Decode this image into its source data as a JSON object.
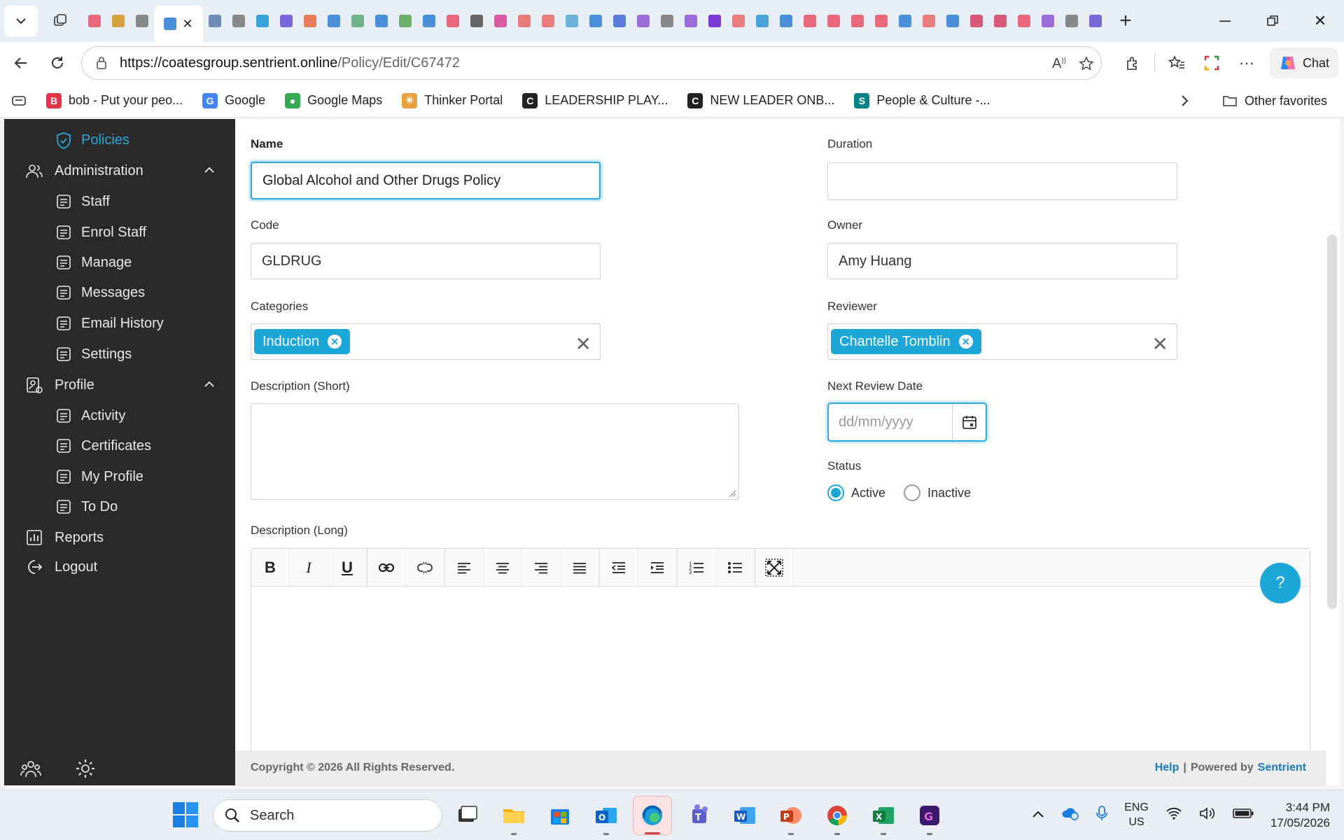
{
  "browser": {
    "url_host": "https://coatesgroup.sentrient.online",
    "url_path": "/Policy/Edit/C67472",
    "chat_label": "Chat",
    "tab_favicon_colors": [
      "#e8697a",
      "#d4a23c",
      "#888",
      "#4a8fd8",
      "#6d8bb5",
      "#888",
      "#3aa3d8",
      "#7b68d8",
      "#e87c5a",
      "#4a8fd8",
      "#6db38a",
      "#4a8fd8",
      "#6bb06b",
      "#4a8fd8",
      "#e8697a",
      "#666",
      "#d85aa0",
      "#e87c7c",
      "#e87c7c",
      "#6bb0d8",
      "#4a8fd8",
      "#5a7bd8",
      "#9b6bd8",
      "#888",
      "#9b6bd8",
      "#7a3ad8",
      "#e87c7c",
      "#4aa3d8",
      "#4a8fd8",
      "#e8697a",
      "#e8697a",
      "#e8697a",
      "#e8697a",
      "#4a8fd8",
      "#e87c7c",
      "#4a8fd8",
      "#d8587a",
      "#d8587a",
      "#e8697a",
      "#9b6bd8",
      "#888",
      "#7b68d8"
    ]
  },
  "favorites": {
    "items": [
      {
        "label": "bob - Put your peo...",
        "icon": "bob-icon",
        "color": "#e0344b",
        "glyph": "B"
      },
      {
        "label": "Google",
        "icon": "google-icon",
        "color": "#4285f4",
        "glyph": "G"
      },
      {
        "label": "Google Maps",
        "icon": "google-maps-icon",
        "color": "#34a853",
        "glyph": "●"
      },
      {
        "label": "Thinker Portal",
        "icon": "thinker-icon",
        "color": "#e8a13c",
        "glyph": "✳"
      },
      {
        "label": "LEADERSHIP PLAY...",
        "icon": "leadership-icon",
        "color": "#222",
        "glyph": "C"
      },
      {
        "label": "NEW LEADER ONB...",
        "icon": "new-leader-icon",
        "color": "#222",
        "glyph": "C"
      },
      {
        "label": "People & Culture -...",
        "icon": "sharepoint-icon",
        "color": "#038387",
        "glyph": "S"
      }
    ],
    "other_label": "Other favorites"
  },
  "sidebar": {
    "items": [
      {
        "label": "Policies",
        "level": 2,
        "icon": "shield-icon",
        "active": true
      },
      {
        "label": "Administration",
        "level": 1,
        "icon": "people-icon",
        "expanded": true
      },
      {
        "label": "Staff",
        "level": 2,
        "icon": "staff-icon"
      },
      {
        "label": "Enrol Staff",
        "level": 2,
        "icon": "enrol-icon"
      },
      {
        "label": "Manage",
        "level": 2,
        "icon": "manage-icon"
      },
      {
        "label": "Messages",
        "level": 2,
        "icon": "messages-icon"
      },
      {
        "label": "Email History",
        "level": 2,
        "icon": "email-history-icon"
      },
      {
        "label": "Settings",
        "level": 2,
        "icon": "settings-icon"
      },
      {
        "label": "Profile",
        "level": 1,
        "icon": "profile-icon",
        "expanded": true
      },
      {
        "label": "Activity",
        "level": 2,
        "icon": "activity-icon"
      },
      {
        "label": "Certificates",
        "level": 2,
        "icon": "certificates-icon"
      },
      {
        "label": "My Profile",
        "level": 2,
        "icon": "my-profile-icon"
      },
      {
        "label": "To Do",
        "level": 2,
        "icon": "todo-icon"
      },
      {
        "label": "Reports",
        "level": 1,
        "icon": "reports-icon"
      },
      {
        "label": "Logout",
        "level": 1,
        "icon": "logout-icon"
      }
    ]
  },
  "form": {
    "name_label": "Name",
    "name_value": "Global Alcohol and Other Drugs Policy",
    "duration_label": "Duration",
    "duration_value": "",
    "code_label": "Code",
    "code_value": "GLDRUG",
    "owner_label": "Owner",
    "owner_value": "Amy Huang",
    "categories_label": "Categories",
    "categories_chip": "Induction",
    "reviewer_label": "Reviewer",
    "reviewer_chip": "Chantelle Tomblin",
    "desc_short_label": "Description (Short)",
    "next_review_label": "Next Review Date",
    "next_review_placeholder": "dd/mm/yyyy",
    "status_label": "Status",
    "status_active": "Active",
    "status_inactive": "Inactive",
    "status_selected": "Active",
    "desc_long_label": "Description (Long)"
  },
  "footer": {
    "copyright": "Copyright © 2026 All Rights Reserved.",
    "help": "Help",
    "powered_by": "Powered by",
    "brand": "Sentrient"
  },
  "help_fab": "?",
  "taskbar": {
    "search_placeholder": "Search",
    "lang_line1": "ENG",
    "lang_line2": "US",
    "time": "3:44 PM",
    "date": "17/05/2026"
  }
}
